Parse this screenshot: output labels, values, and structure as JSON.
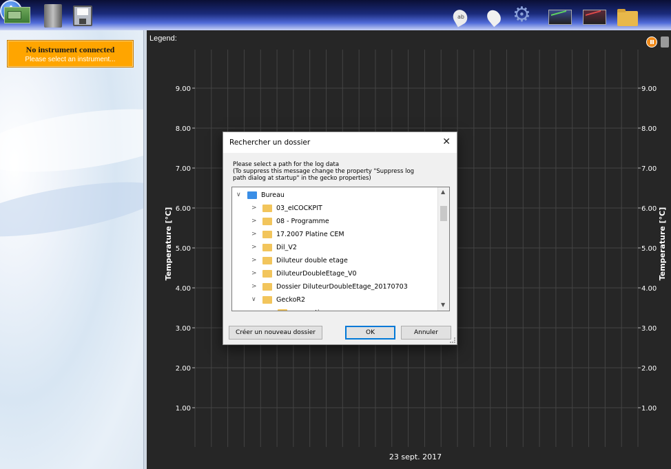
{
  "toolbar": {
    "icons": [
      "instrument-board-icon",
      "instrument-tower-icon",
      "save-disk-icon",
      "sensor-icon",
      "drop-icon",
      "settings-gear-icon",
      "chart-green-icon",
      "chart-red-icon",
      "folder-icon",
      "info-icon"
    ]
  },
  "status": {
    "title": "No instrument connected",
    "subtitle": "Please select an instrument..."
  },
  "chart": {
    "legend_label": "Legend:",
    "ylabel_left": "Temperature [°C]",
    "ylabel_right": "Temperature [°C]",
    "date_label": "23 sept. 2017",
    "yticks": [
      "9.00",
      "8.00",
      "7.00",
      "6.00",
      "5.00",
      "4.00",
      "3.00",
      "2.00",
      "1.00"
    ],
    "background": "#262626"
  },
  "dialog": {
    "title": "Rechercher un dossier",
    "close": "✕",
    "message_lines": [
      "Please select a path for the log data",
      "(To suppress this message change the property \"Suppress log",
      "path dialog at startup\" in the gecko properties)"
    ],
    "tree": [
      {
        "label": "Bureau",
        "chev": "∨",
        "folder": "blue",
        "level": 0
      },
      {
        "label": "03_eICOCKPIT",
        "chev": ">",
        "folder": "yellow",
        "level": 1
      },
      {
        "label": "08 - Programme",
        "chev": ">",
        "folder": "yellow",
        "level": 1
      },
      {
        "label": "17.2007 Platine CEM",
        "chev": ">",
        "folder": "yellow",
        "level": 1
      },
      {
        "label": "Dil_V2",
        "chev": ">",
        "folder": "yellow",
        "level": 1
      },
      {
        "label": "Diluteur double etage",
        "chev": ">",
        "folder": "yellow",
        "level": 1
      },
      {
        "label": "DiluteurDoubleEtage_V0",
        "chev": ">",
        "folder": "yellow",
        "level": 1
      },
      {
        "label": "Dossier DiluteurDoubleEtage_20170703",
        "chev": ">",
        "folder": "yellow",
        "level": 1
      },
      {
        "label": "GeckoR2",
        "chev": "∨",
        "folder": "yellow",
        "level": 1
      },
      {
        "label": "connections",
        "chev": "",
        "folder": "yellow",
        "level": 2
      }
    ],
    "buttons": {
      "new_folder": "Créer un nouveau dossier",
      "ok": "OK",
      "cancel": "Annuler"
    }
  }
}
